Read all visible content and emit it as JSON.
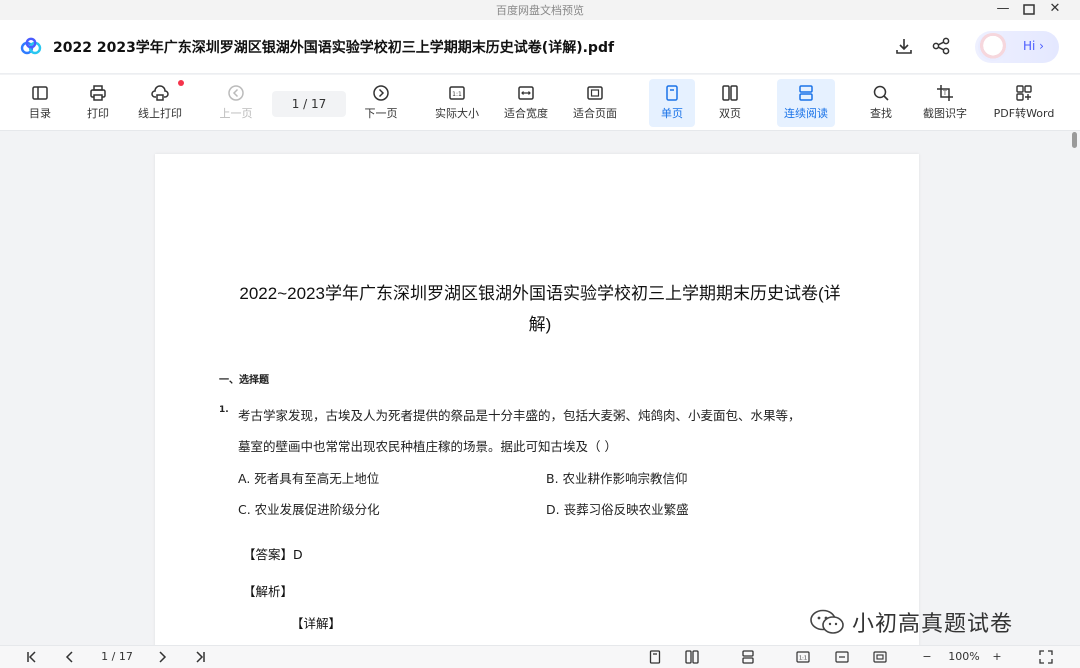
{
  "window": {
    "app_title": "百度网盘文档预览"
  },
  "document": {
    "file_title": "2022  2023学年广东深圳罗湖区银湖外国语实验学校初三上学期期末历史试卷(详解).pdf"
  },
  "header": {
    "assistant_label": "Hi ›"
  },
  "toolbar": {
    "items": [
      {
        "label": "目录",
        "icon": "toc-icon"
      },
      {
        "label": "打印",
        "icon": "print-icon"
      },
      {
        "label": "线上打印",
        "icon": "cloud-print-icon"
      },
      {
        "label": "上一页",
        "icon": "prev-page-icon"
      },
      {
        "label": "下一页",
        "icon": "next-page-icon"
      },
      {
        "label": "实际大小",
        "icon": "actual-size-icon"
      },
      {
        "label": "适合宽度",
        "icon": "fit-width-icon"
      },
      {
        "label": "适合页面",
        "icon": "fit-page-icon"
      },
      {
        "label": "单页",
        "icon": "single-page-icon"
      },
      {
        "label": "双页",
        "icon": "double-page-icon"
      },
      {
        "label": "连续阅读",
        "icon": "continuous-icon"
      },
      {
        "label": "查找",
        "icon": "search-icon"
      },
      {
        "label": "截图识字",
        "icon": "screenshot-ocr-icon"
      },
      {
        "label": "PDF转Word",
        "icon": "pdf-to-word-icon"
      }
    ],
    "page_indicator": "1 / 17"
  },
  "page": {
    "heading_line1": "2022~2023学年广东深圳罗湖区银湖外国语实验学校初三上学期期末历史试卷(详",
    "heading_line2": "解)",
    "section_title": "一、选择题",
    "question_number": "1.",
    "question_line1": "考古学家发现，古埃及人为死者提供的祭品是十分丰盛的，包括大麦粥、炖鸽肉、小麦面包、水果等，",
    "question_line2": "墓室的壁画中也常常出现农民种植庄稼的场景。据此可知古埃及（     ）",
    "options": {
      "a": "A. 死者具有至高无上地位",
      "b": "B. 农业耕作影响宗教信仰",
      "c": "C. 农业发展促进阶级分化",
      "d": "D. 丧葬习俗反映农业繁盛"
    },
    "answer_label": "【答案】",
    "answer_value": "D",
    "analysis_label": "【解析】",
    "detail_label": "【详解】"
  },
  "watermark": {
    "text": "小初高真题试卷"
  },
  "statusbar": {
    "page_indicator": "1 / 17",
    "zoom": "100%"
  },
  "colors": {
    "accent": "#1a73e8",
    "active_bg": "#e6f1ff",
    "notify_dot": "#f5334b"
  }
}
